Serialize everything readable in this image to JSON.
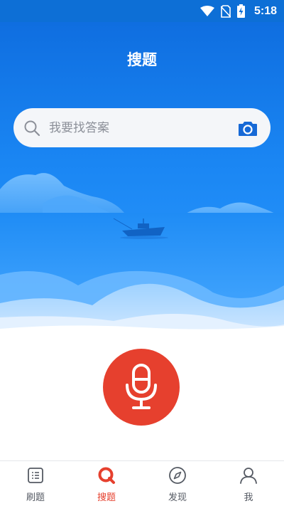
{
  "status_bar": {
    "time": "5:18",
    "icons": [
      "wifi-icon",
      "no-sim-icon",
      "battery-charging-icon"
    ]
  },
  "header": {
    "title": "搜题"
  },
  "search": {
    "placeholder": "我要找答案",
    "value": "",
    "left_icon": "search-icon",
    "right_icon": "camera-icon"
  },
  "voice": {
    "icon": "microphone-icon"
  },
  "tabs": [
    {
      "label": "刷题",
      "icon": "list-icon",
      "active": false
    },
    {
      "label": "搜题",
      "icon": "search-ring-icon",
      "active": true
    },
    {
      "label": "发现",
      "icon": "compass-icon",
      "active": false
    },
    {
      "label": "我",
      "icon": "user-icon",
      "active": false
    }
  ],
  "colors": {
    "primary_blue": "#1a86f3",
    "accent_red": "#e6402e",
    "inactive_tab": "#555a63"
  }
}
